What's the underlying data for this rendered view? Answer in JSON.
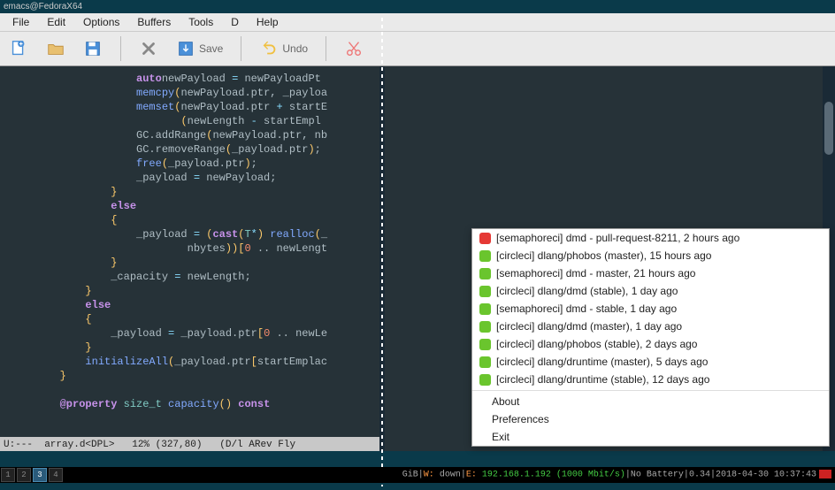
{
  "window": {
    "title": "emacs@FedoraX64"
  },
  "menu": {
    "items": [
      "File",
      "Edit",
      "Options",
      "Buffers",
      "Tools",
      "D",
      "Help"
    ]
  },
  "toolbar": {
    "save_label": "Save",
    "undo_label": "Undo"
  },
  "code": {
    "lines": [
      {
        "indent": 20,
        "tokens": [
          [
            "kw",
            "auto"
          ],
          [
            "",
            ""
          ],
          [
            "",
            "newPayload "
          ],
          [
            "op",
            "="
          ],
          [
            "",
            " newPayloadPt"
          ]
        ]
      },
      {
        "indent": 20,
        "tokens": [
          [
            "fn",
            "memcpy"
          ],
          [
            "br",
            "("
          ],
          [
            "",
            "newPayload.ptr, _payloa"
          ]
        ]
      },
      {
        "indent": 20,
        "tokens": [
          [
            "fn",
            "memset"
          ],
          [
            "br",
            "("
          ],
          [
            "",
            "newPayload.ptr "
          ],
          [
            "op",
            "+"
          ],
          [
            "",
            " startE"
          ]
        ]
      },
      {
        "indent": 27,
        "tokens": [
          [
            "br",
            "("
          ],
          [
            "",
            "newLength "
          ],
          [
            "op",
            "-"
          ],
          [
            "",
            " startEmpl"
          ]
        ]
      },
      {
        "indent": 20,
        "tokens": [
          [
            "",
            "GC.addRange"
          ],
          [
            "br",
            "("
          ],
          [
            "",
            "newPayload.ptr, nb"
          ]
        ]
      },
      {
        "indent": 20,
        "tokens": [
          [
            "",
            "GC.removeRange"
          ],
          [
            "br",
            "("
          ],
          [
            "",
            "_payload.ptr"
          ],
          [
            "br",
            ")"
          ],
          [
            "",
            ";"
          ]
        ]
      },
      {
        "indent": 20,
        "tokens": [
          [
            "fn",
            "free"
          ],
          [
            "br",
            "("
          ],
          [
            "",
            "_payload.ptr"
          ],
          [
            "br",
            ")"
          ],
          [
            "",
            ";"
          ]
        ]
      },
      {
        "indent": 20,
        "tokens": [
          [
            "",
            "_payload "
          ],
          [
            "op",
            "="
          ],
          [
            "",
            " newPayload;"
          ]
        ]
      },
      {
        "indent": 16,
        "tokens": [
          [
            "br",
            "}"
          ]
        ]
      },
      {
        "indent": 16,
        "tokens": [
          [
            "kw",
            "else"
          ]
        ]
      },
      {
        "indent": 16,
        "tokens": [
          [
            "br",
            "{"
          ]
        ]
      },
      {
        "indent": 20,
        "tokens": [
          [
            "",
            "_payload "
          ],
          [
            "op",
            "="
          ],
          [
            "",
            " "
          ],
          [
            "br",
            "("
          ],
          [
            "kw",
            "cast"
          ],
          [
            "br",
            "("
          ],
          [
            "tp",
            "T"
          ],
          [
            "op",
            "*"
          ],
          [
            "br",
            ")"
          ],
          [
            "",
            " "
          ],
          [
            "fn",
            "realloc"
          ],
          [
            "br",
            "("
          ],
          [
            "",
            "_"
          ]
        ]
      },
      {
        "indent": 28,
        "tokens": [
          [
            "",
            "nbytes"
          ],
          [
            "br",
            "))["
          ],
          [
            "num",
            "0"
          ],
          [
            "",
            " .. newLengt"
          ]
        ]
      },
      {
        "indent": 16,
        "tokens": [
          [
            "br",
            "}"
          ]
        ]
      },
      {
        "indent": 16,
        "tokens": [
          [
            "",
            "_capacity "
          ],
          [
            "op",
            "="
          ],
          [
            "",
            " newLength;"
          ]
        ]
      },
      {
        "indent": 12,
        "tokens": [
          [
            "br",
            "}"
          ]
        ]
      },
      {
        "indent": 12,
        "tokens": [
          [
            "kw",
            "else"
          ]
        ]
      },
      {
        "indent": 12,
        "tokens": [
          [
            "br",
            "{"
          ]
        ]
      },
      {
        "indent": 16,
        "tokens": [
          [
            "",
            "_payload "
          ],
          [
            "op",
            "="
          ],
          [
            "",
            " _payload.ptr"
          ],
          [
            "br",
            "["
          ],
          [
            "num",
            "0"
          ],
          [
            "",
            " .. newLe"
          ]
        ]
      },
      {
        "indent": 12,
        "tokens": [
          [
            "br",
            "}"
          ]
        ]
      },
      {
        "indent": 12,
        "tokens": [
          [
            "fn",
            "initializeAll"
          ],
          [
            "br",
            "("
          ],
          [
            "",
            "_payload.ptr"
          ],
          [
            "br",
            "["
          ],
          [
            "",
            "startEmplac"
          ]
        ]
      },
      {
        "indent": 8,
        "tokens": [
          [
            "br",
            "}"
          ]
        ]
      },
      {
        "indent": 8,
        "tokens": [
          [
            "",
            ""
          ]
        ]
      },
      {
        "indent": 8,
        "tokens": [
          [
            "kw",
            "@property"
          ],
          [
            "",
            " "
          ],
          [
            "tp",
            "size_t"
          ],
          [
            "",
            " "
          ],
          [
            "fn",
            "capacity"
          ],
          [
            "br",
            "()"
          ],
          [
            "",
            " "
          ],
          [
            "kw",
            "const"
          ]
        ]
      }
    ]
  },
  "modeline": "U:---  array.d<DPL>   12% (327,80)   (D/l ARev Fly",
  "popup": {
    "ci": [
      {
        "status": "red",
        "text": "[semaphoreci] dmd - pull-request-8211, 2 hours ago"
      },
      {
        "status": "green",
        "text": "[circleci] dlang/phobos (master), 15 hours ago"
      },
      {
        "status": "green",
        "text": "[semaphoreci] dmd - master, 21 hours ago"
      },
      {
        "status": "green",
        "text": "[circleci] dlang/dmd (stable), 1 day ago"
      },
      {
        "status": "green",
        "text": "[semaphoreci] dmd - stable, 1 day ago"
      },
      {
        "status": "green",
        "text": "[circleci] dlang/dmd (master), 1 day ago"
      },
      {
        "status": "green",
        "text": "[circleci] dlang/phobos (stable), 2 days ago"
      },
      {
        "status": "green",
        "text": "[circleci] dlang/druntime (master), 5 days ago"
      },
      {
        "status": "green",
        "text": "[circleci] dlang/druntime (stable), 12 days ago"
      }
    ],
    "actions": [
      "About",
      "Preferences",
      "Exit"
    ]
  },
  "taskbar": {
    "workspaces": [
      "1",
      "2",
      "3",
      "4"
    ],
    "active_ws": 2,
    "right": {
      "prefix": "GiB",
      "sep1": "|",
      "wlabel": "W: ",
      "wval": "down",
      "sep2": "|",
      "elabel": "E: ",
      "eval": "192.168.1.192 (1000 Mbit/s)",
      "sep3": "|",
      "batt": "No Battery",
      "sep4": "|",
      "load": "0.34",
      "sep5": "|",
      "date": "2018-04-30 10:37:43"
    }
  }
}
